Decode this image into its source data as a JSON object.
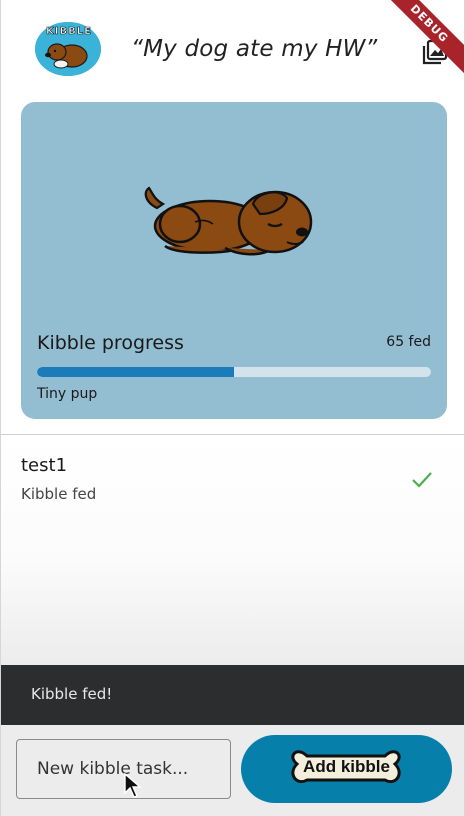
{
  "appbar": {
    "title": "“My dog ate my HW”",
    "logo_text": "KIBBLE",
    "debug_label": "DEBUG",
    "gallery_icon": "photo-library-icon"
  },
  "hero": {
    "image": "sleeping-dog-illustration",
    "progress_label": "Kibble progress",
    "progress_count": "65 fed",
    "progress_fraction": 0.5,
    "level_label": "Tiny pup"
  },
  "tasks": [
    {
      "title": "test1",
      "status": "Kibble fed",
      "done": true
    }
  ],
  "snackbar": {
    "message": "Kibble fed!"
  },
  "composer": {
    "placeholder": "New kibble task...",
    "value": "",
    "add_label": "Add kibble"
  },
  "colors": {
    "card": "#93bdd0",
    "accent": "#1a7dba",
    "button": "#077fab",
    "check": "#4caf50",
    "snackbar": "#2b2d2f"
  }
}
